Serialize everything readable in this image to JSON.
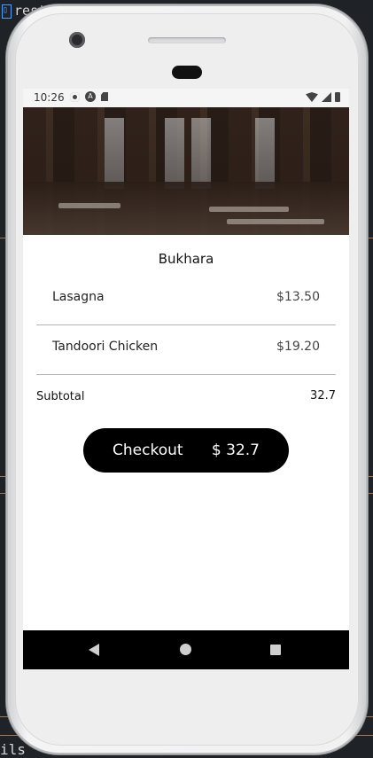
{
  "ide": {
    "tab_label": "rest",
    "bottom_text": "ils"
  },
  "status_bar": {
    "time": "10:26"
  },
  "restaurant": {
    "name": "Bukhara"
  },
  "cart": {
    "items": [
      {
        "name": "Lasagna",
        "price": "$13.50"
      },
      {
        "name": "Tandoori Chicken",
        "price": "$19.20"
      }
    ],
    "subtotal_label": "Subtotal",
    "subtotal_value": "32.7"
  },
  "checkout": {
    "label": "Checkout",
    "amount": "$ 32.7"
  },
  "icons": {
    "status_left": [
      "settings-icon",
      "a-badge-icon",
      "sd-card-icon"
    ],
    "status_right": [
      "wifi-icon",
      "signal-icon",
      "battery-icon"
    ],
    "nav": [
      "back-icon",
      "home-icon",
      "recents-icon"
    ]
  },
  "colors": {
    "button_bg": "#000000",
    "button_text": "#ffffff",
    "divider": "#b5b5b5"
  }
}
